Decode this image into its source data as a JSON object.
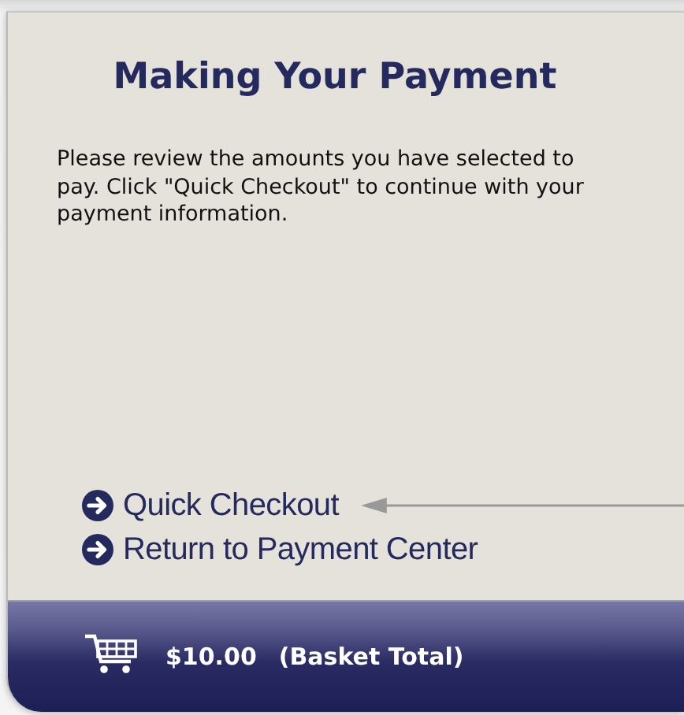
{
  "panel": {
    "title": "Making Your Payment",
    "instructions": "Please review the amounts you have selected to pay. Click \"Quick Checkout\" to continue with your payment information.",
    "links": [
      {
        "label": "Quick Checkout",
        "pointer": true
      },
      {
        "label": "Return to Payment Center",
        "pointer": false
      }
    ],
    "basket": {
      "amount": "$10.00",
      "label": "(Basket Total)"
    }
  }
}
